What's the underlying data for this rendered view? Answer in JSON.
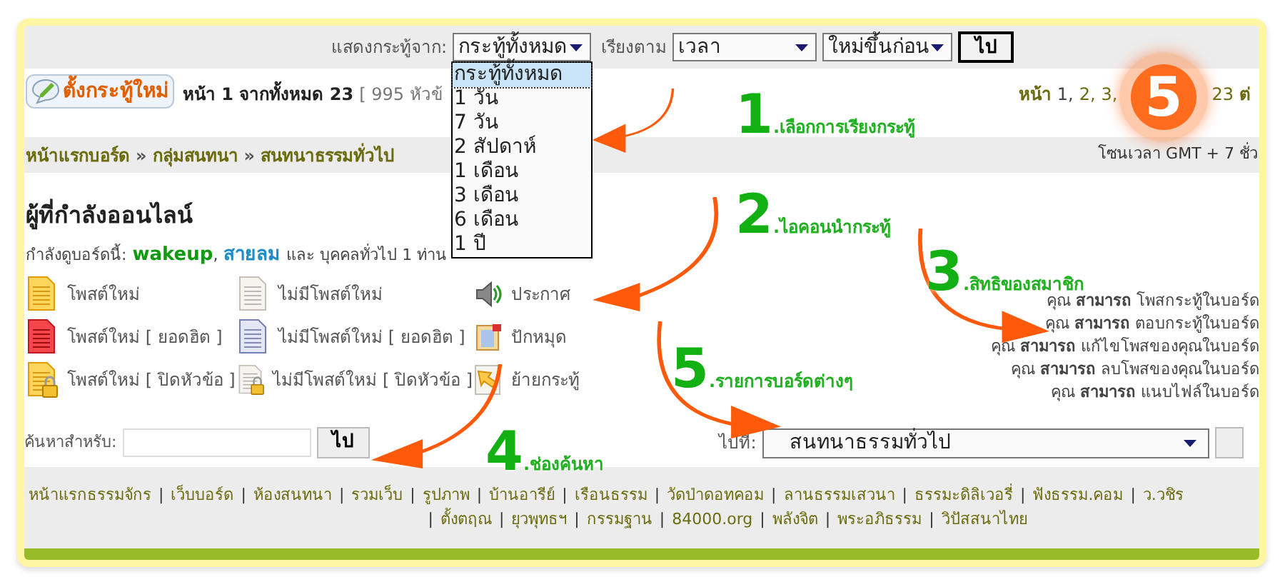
{
  "toolbar": {
    "show_label": "แสดงกระทู้จาก:",
    "show_select": {
      "value": "กระทู้ทั้งหมด",
      "expanded": true,
      "options": [
        {
          "label": "กระทู้ทั้งหมด",
          "selected": true
        },
        {
          "label": "1 วัน",
          "selected": false
        },
        {
          "label": "7 วัน",
          "selected": false
        },
        {
          "label": "2 สัปดาห์",
          "selected": false
        },
        {
          "label": "1 เดือน",
          "selected": false
        },
        {
          "label": "3 เดือน",
          "selected": false
        },
        {
          "label": "6 เดือน",
          "selected": false
        },
        {
          "label": "1 ปี",
          "selected": false
        }
      ]
    },
    "sort_label": "เรียงตาม",
    "sort_select": "เวลา",
    "order_select": "ใหม่ขึ้นก่อน",
    "go_button": "ไป"
  },
  "topic_bar": {
    "new_topic_button": "ตั้งกระทู้ใหม่",
    "page_info": "หน้า 1 จากทั้งหมด 23",
    "topic_count": "[ 995 หัวข้",
    "pagination": {
      "label": "หน้า",
      "pages": [
        {
          "label": "1,",
          "selected": true
        },
        {
          "label": "2,",
          "selected": false
        },
        {
          "label": "3,",
          "selected": false
        },
        {
          "label": "23",
          "selected": false
        }
      ],
      "next": "ต่"
    }
  },
  "breadcrumb": {
    "items": [
      "หน้าแรกบอร์ด",
      "กลุ่มสนทนา",
      "สนทนาธรรมทั่วไป"
    ],
    "separator": "»",
    "timezone": "โซนเวลา GMT + 7 ชั่ว"
  },
  "online": {
    "title": "ผู้ที่กำลังออนไลน์",
    "prefix": "กำลังดูบอร์ดนี้:",
    "users": [
      {
        "name": "wakeup",
        "color": "#109a10"
      },
      {
        "name": "สายลม",
        "color": "#1c8fc8"
      }
    ],
    "separator": ",",
    "suffix": "และ บุคคลทั่วไป 1 ท่าน"
  },
  "legend": [
    {
      "kind": "new",
      "label": "โพสต์ใหม่"
    },
    {
      "kind": "no_new",
      "label": "ไม่มีโพสต์ใหม่"
    },
    {
      "kind": "announce",
      "label": "ประกาศ"
    },
    {
      "kind": "new_hot",
      "label": "โพสต์ใหม่ [ ยอดฮิต ]"
    },
    {
      "kind": "no_new_hot",
      "label": "ไม่มีโพสต์ใหม่ [ ยอดฮิต ]"
    },
    {
      "kind": "sticky",
      "label": "ปักหมุด"
    },
    {
      "kind": "new_locked",
      "label": "โพสต์ใหม่ [ ปิดหัวข้อ ]"
    },
    {
      "kind": "no_new_locked",
      "label": "ไม่มีโพสต์ใหม่ [ ปิดหัวข้อ ]"
    },
    {
      "kind": "moved",
      "label": "ย้ายกระทู้"
    }
  ],
  "permissions": [
    "คุณ **สามารถ** โพสกระทู้ในบอร์ด",
    "คุณ **สามารถ** ตอบกระทู้ในบอร์ด",
    "คุณ **สามารถ** แก้ไขโพสของคุณในบอร์ด",
    "คุณ **สามารถ** ลบโพสของคุณในบอร์ด",
    "คุณ **สามารถ** แนบไฟล์ในบอร์ด"
  ],
  "search": {
    "label": "ค้นหาสำหรับ:",
    "go_button": "ไป"
  },
  "jump": {
    "label": "ไปที่:",
    "value": "สนทนาธรรมทั่วไป"
  },
  "footer": {
    "separator": "|",
    "rows": [
      {
        "leading_separator": false,
        "links": [
          "หน้าแรกธรรมจักร",
          "เว็บบอร์ด",
          "ห้องสนทนา",
          "รวมเว็บ",
          "รูปภาพ",
          "บ้านอารีย์",
          "เรือนธรรม",
          "วัดป่าดอทคอม",
          "ลานธรรมเสวนา",
          "ธรรมะดิลิเวอรี่",
          "ฟังธรรม.คอม",
          "ว.วชิร"
        ]
      },
      {
        "leading_separator": true,
        "links": [
          "ตั้งตฤณ",
          "ยุวพุทธฯ",
          "กรรมฐาน",
          "84000.org",
          "พลังจิต",
          "พระอภิธรรม",
          "วิปัสสนาไทย"
        ]
      }
    ]
  },
  "annotations": [
    {
      "number": "1",
      "label": ".เลือกการเรียงกระทู้"
    },
    {
      "number": "2",
      "label": ".ไอคอนนำกระทู้"
    },
    {
      "number": "3",
      "label": ".สิทธิของสมาชิก"
    },
    {
      "number": "4",
      "label": ".ช่องค้นหา"
    },
    {
      "number": "5",
      "label": ".รายการบอร์ดต่างๆ"
    }
  ],
  "badge": "5"
}
